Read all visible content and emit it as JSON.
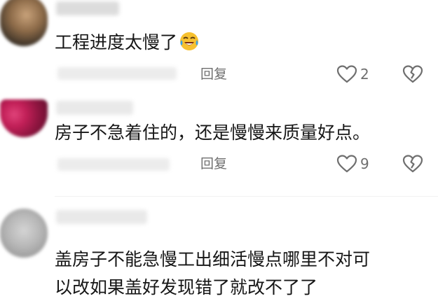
{
  "comments": [
    {
      "text": "工程进度太慢了",
      "emoji": "crying-laughing-emoji",
      "reply_label": "回复",
      "like_count": "2"
    },
    {
      "text": "房子不急着住的，还是慢慢来质量好点。",
      "reply_label": "回复",
      "like_count": "9"
    },
    {
      "text_line1": "盖房子不能急慢工出细活慢点哪里不对可",
      "text_line2": "以改如果盖好发现错了就改不了了"
    }
  ],
  "colors": {
    "text": "#161616",
    "meta": "#6f6f6f",
    "emoji_face": "#f7c12f",
    "emoji_tear": "#3aa0e8"
  }
}
